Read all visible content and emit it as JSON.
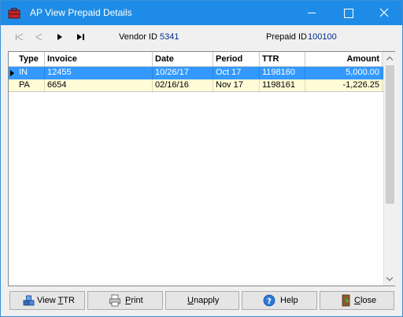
{
  "window": {
    "title": "AP View Prepaid Details",
    "title_bar_color": "#1e8ce6"
  },
  "nav": {
    "vendor_label": "Vendor ID",
    "vendor_value": "5341",
    "prepaid_label": "Prepaid ID",
    "prepaid_value": "100100"
  },
  "grid": {
    "columns": [
      "Type",
      "Invoice",
      "Date",
      "Period",
      "TTR",
      "Amount"
    ],
    "rows": [
      {
        "type": "IN",
        "invoice": "12455",
        "date": "10/26/17",
        "period": "Oct 17",
        "ttr": "1198160",
        "amount": "5,000.00",
        "selected": true
      },
      {
        "type": "PA",
        "invoice": "6654",
        "date": "02/16/16",
        "period": "Nov 17",
        "ttr": "1198161",
        "amount": "-1,226.25",
        "selected": false
      }
    ],
    "selection_color": "#3399ff",
    "alt_row_color": "#fffbd6"
  },
  "buttons": {
    "view_ttr": {
      "pre": "View ",
      "accel": "T",
      "post": "TR"
    },
    "print": {
      "pre": "",
      "accel": "P",
      "post": "rint"
    },
    "unapply": {
      "pre": "",
      "accel": "U",
      "post": "napply"
    },
    "help": {
      "pre": "",
      "accel": "",
      "post": "Help"
    },
    "close": {
      "pre": "",
      "accel": "C",
      "post": "lose"
    }
  },
  "icons": {
    "app": "briefcase-icon",
    "view_ttr": "boxes-icon",
    "print": "printer-icon",
    "help": "question-icon",
    "close": "door-exit-icon"
  }
}
